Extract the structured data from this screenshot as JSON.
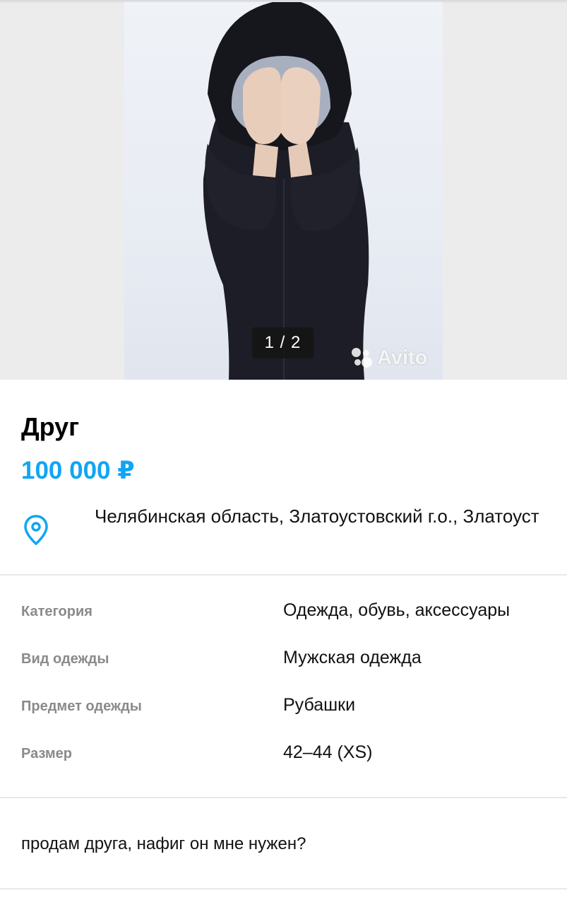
{
  "gallery": {
    "counter": "1 / 2",
    "watermark": "Avito",
    "photo_description": "person in black hoodie covering face"
  },
  "listing": {
    "title": "Друг",
    "price": "100 000 ₽",
    "address": "Челябинская область, Златоустовский г.о., Златоуст"
  },
  "params": [
    {
      "label": "Категория",
      "value": "Одежда, обувь, аксессуары"
    },
    {
      "label": "Вид одежды",
      "value": "Мужская одежда"
    },
    {
      "label": "Предмет одежды",
      "value": "Рубашки"
    },
    {
      "label": "Размер",
      "value": "42–44 (XS)"
    }
  ],
  "description": "продам друга, нафиг он мне нужен?",
  "colors": {
    "price": "#11a5f4",
    "label": "#8a8a8a",
    "divider": "#e8e8e8"
  }
}
